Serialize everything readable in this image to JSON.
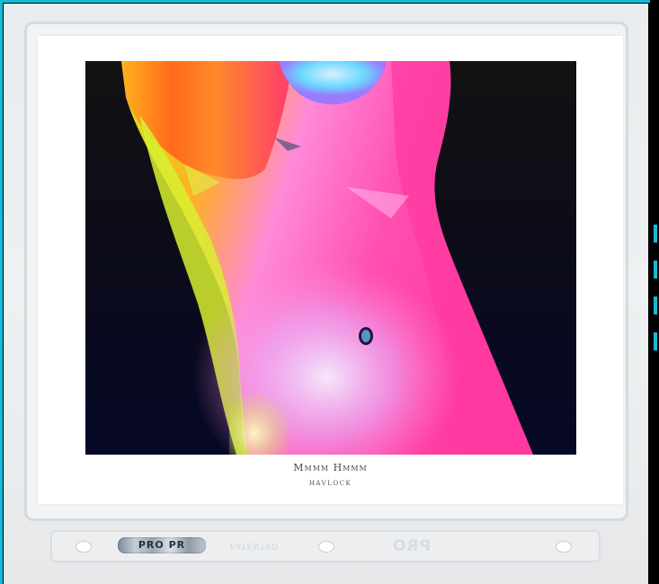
{
  "artwork": {
    "title": "Mmmm Hmmm",
    "artist": "havlock"
  },
  "sleeve": {
    "hologram_label": "PRO PR",
    "embossed_brand": "PRO",
    "embossed_small": "PATENTED"
  },
  "colors": {
    "cyan_edge": "#19b9d6",
    "background_top": "#121212",
    "background_bottom": "#060827",
    "orange": "#ff6a1a",
    "yellow_green": "#c8f020",
    "magenta": "#ff4fb0",
    "pink": "#ff8ad8",
    "lavender": "#e8b8ff"
  }
}
